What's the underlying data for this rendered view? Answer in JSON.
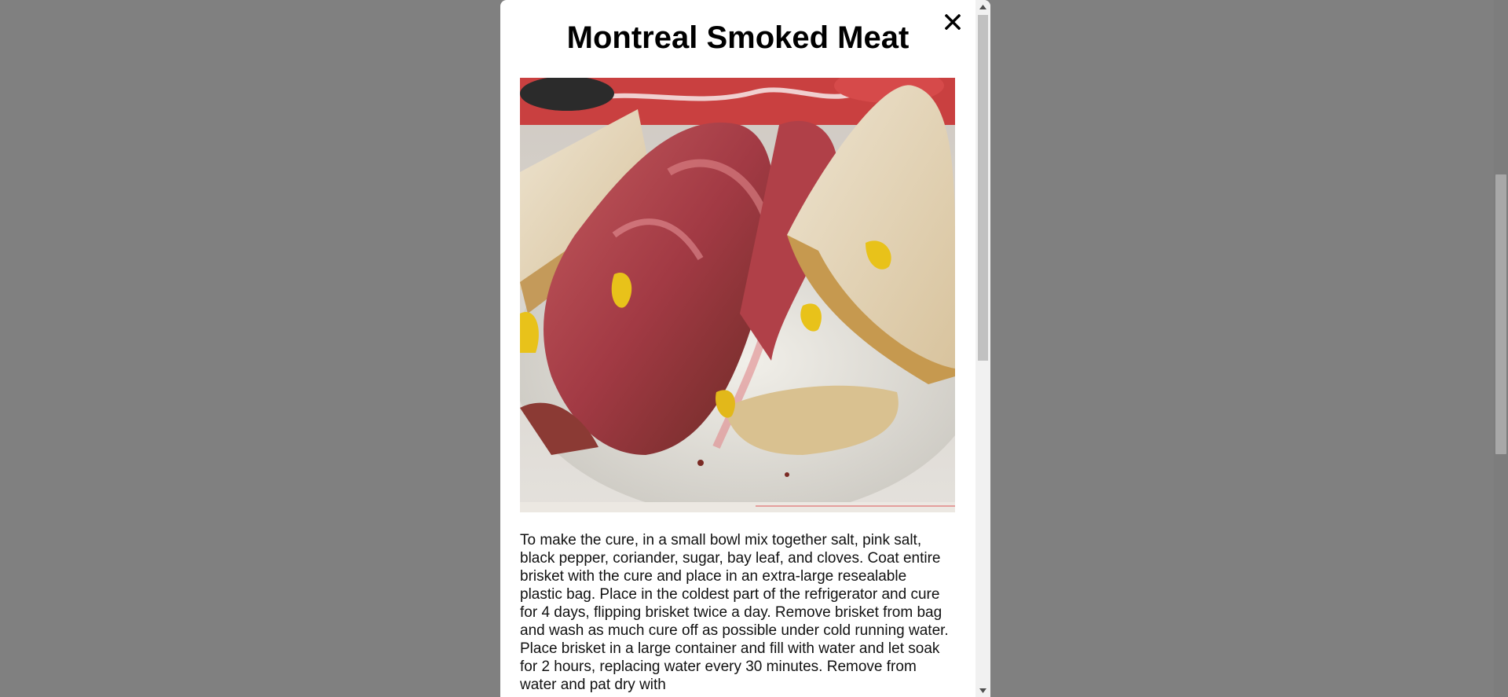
{
  "modal": {
    "title": "Montreal Smoked Meat",
    "close_icon": "close-icon",
    "image_alt": "Montreal smoked meat sandwich on rye bread with mustard",
    "description": "To make the cure, in a small bowl mix together salt, pink salt, black pepper, coriander, sugar, bay leaf, and cloves. Coat entire brisket with the cure and place in an extra-large resealable plastic bag. Place in the coldest part of the refrigerator and cure for 4 days, flipping brisket twice a day. Remove brisket from bag and wash as much cure off as possible under cold running water. Place brisket in a large container and fill with water and let soak for 2 hours, replacing water every 30 minutes. Remove from water and pat dry with"
  },
  "colors": {
    "overlay": "#808080",
    "modal_background": "#ffffff",
    "text": "#111111"
  }
}
